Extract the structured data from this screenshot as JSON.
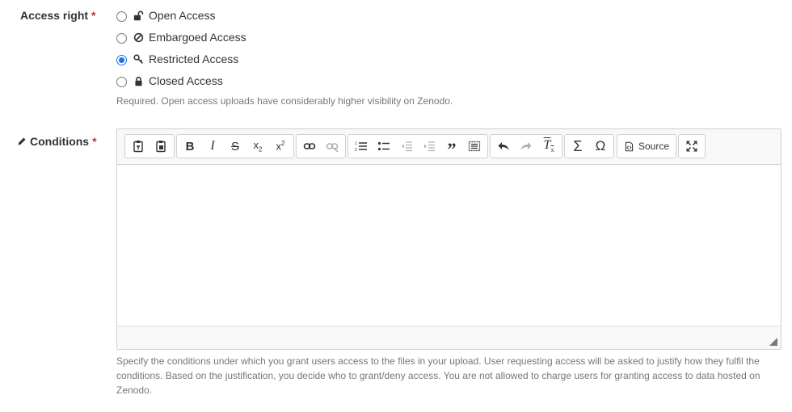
{
  "access_right": {
    "label": "Access right",
    "required_mark": "*",
    "options": [
      {
        "label": "Open Access",
        "icon": "unlock-icon",
        "selected": false
      },
      {
        "label": "Embargoed Access",
        "icon": "ban-icon",
        "selected": false
      },
      {
        "label": "Restricted Access",
        "icon": "key-icon",
        "selected": true
      },
      {
        "label": "Closed Access",
        "icon": "lock-icon",
        "selected": false
      }
    ],
    "help": "Required. Open access uploads have considerably higher visibility on Zenodo."
  },
  "conditions": {
    "label": "Conditions",
    "required_mark": "*",
    "icon": "pencil-icon",
    "source_label": "Source",
    "help": "Specify the conditions under which you grant users access to the files in your upload. User requesting access will be asked to justify how they fulfil the conditions. Based on the justification, you decide who to grant/deny access. You are not allowed to charge users for granting access to data hosted on Zenodo."
  }
}
